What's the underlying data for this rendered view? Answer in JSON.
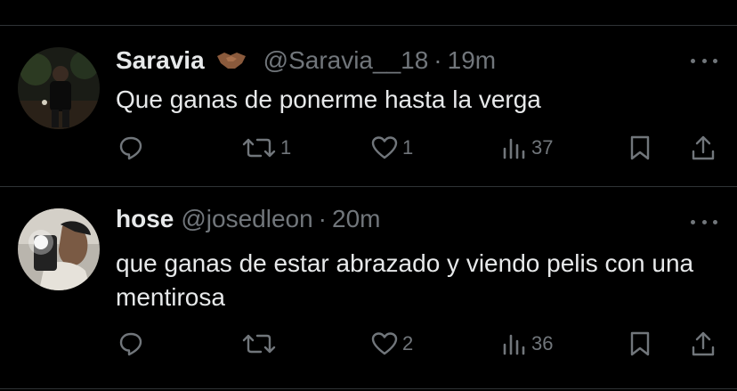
{
  "tweets": [
    {
      "name": "Saravia",
      "handle": "@Saravia__18",
      "separator": "·",
      "time": "19m",
      "text": "Que ganas de ponerme hasta la verga",
      "retweets": "1",
      "likes": "1",
      "views": "37",
      "replies": ""
    },
    {
      "name": "hose",
      "handle": "@josedleon",
      "separator": "·",
      "time": "20m",
      "text": "que ganas de estar abrazado y viendo pelis con una mentirosa",
      "retweets": "",
      "likes": "2",
      "views": "36",
      "replies": ""
    }
  ],
  "icons": {
    "reply": "reply-icon",
    "retweet": "retweet-icon",
    "like": "heart-icon",
    "views": "views-icon",
    "bookmark": "bookmark-icon",
    "share": "share-icon",
    "more": "more-icon",
    "emoji": "handshake-icon"
  },
  "colors": {
    "background": "#000000",
    "text": "#e7e9ea",
    "muted": "#71767b",
    "divider": "#2f3336"
  }
}
